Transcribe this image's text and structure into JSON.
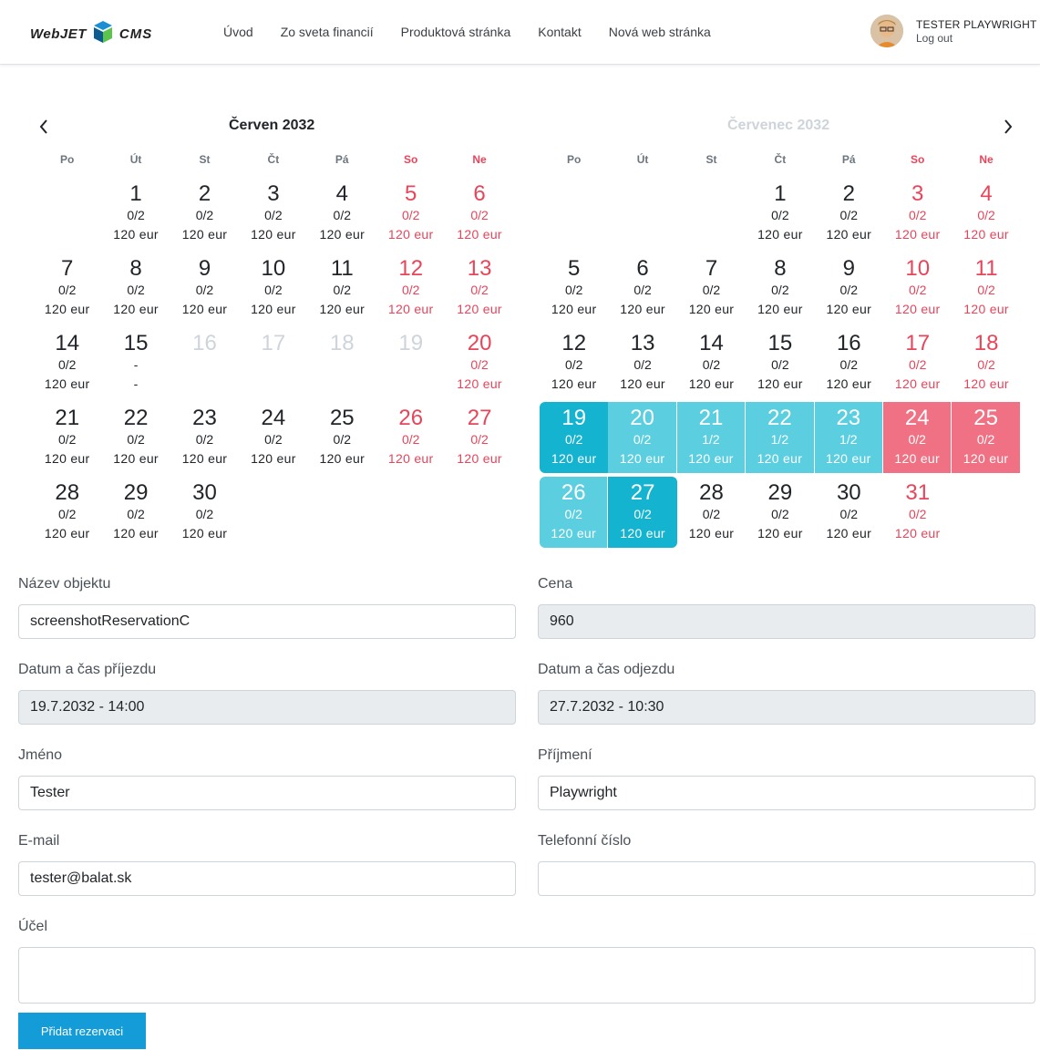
{
  "header": {
    "logo_web": "WebJET",
    "logo_cms": "CMS",
    "nav": [
      "Úvod",
      "Zo sveta financií",
      "Produktová stránka",
      "Kontakt",
      "Nová web stránka"
    ],
    "user_name": "TESTER PLAYWRIGHT",
    "logout": "Log out"
  },
  "calendar": {
    "dow": [
      "Po",
      "Út",
      "St",
      "Čt",
      "Pá",
      "So",
      "Ne"
    ],
    "left_title": "Červen  2032",
    "right_title": "Červenec  2032",
    "prev_icon": "chevron-left-icon",
    "next_icon": "chevron-right-icon",
    "june": [
      {
        "d": "1",
        "o": "0/2",
        "p": "120 eur"
      },
      {
        "d": "2",
        "o": "0/2",
        "p": "120 eur"
      },
      {
        "d": "3",
        "o": "0/2",
        "p": "120 eur"
      },
      {
        "d": "4",
        "o": "0/2",
        "p": "120 eur"
      },
      {
        "d": "5",
        "o": "0/2",
        "p": "120 eur"
      },
      {
        "d": "6",
        "o": "0/2",
        "p": "120 eur"
      },
      {
        "d": "7",
        "o": "0/2",
        "p": "120 eur"
      },
      {
        "d": "8",
        "o": "0/2",
        "p": "120 eur"
      },
      {
        "d": "9",
        "o": "0/2",
        "p": "120 eur"
      },
      {
        "d": "10",
        "o": "0/2",
        "p": "120 eur"
      },
      {
        "d": "11",
        "o": "0/2",
        "p": "120 eur"
      },
      {
        "d": "12",
        "o": "0/2",
        "p": "120 eur"
      },
      {
        "d": "13",
        "o": "0/2",
        "p": "120 eur"
      },
      {
        "d": "14",
        "o": "0/2",
        "p": "120 eur"
      },
      {
        "d": "15",
        "o": "-",
        "p": "-"
      },
      {
        "d": "16",
        "o": "",
        "p": ""
      },
      {
        "d": "17",
        "o": "",
        "p": ""
      },
      {
        "d": "18",
        "o": "",
        "p": ""
      },
      {
        "d": "19",
        "o": "",
        "p": ""
      },
      {
        "d": "20",
        "o": "0/2",
        "p": "120 eur"
      },
      {
        "d": "21",
        "o": "0/2",
        "p": "120 eur"
      },
      {
        "d": "22",
        "o": "0/2",
        "p": "120 eur"
      },
      {
        "d": "23",
        "o": "0/2",
        "p": "120 eur"
      },
      {
        "d": "24",
        "o": "0/2",
        "p": "120 eur"
      },
      {
        "d": "25",
        "o": "0/2",
        "p": "120 eur"
      },
      {
        "d": "26",
        "o": "0/2",
        "p": "120 eur"
      },
      {
        "d": "27",
        "o": "0/2",
        "p": "120 eur"
      },
      {
        "d": "28",
        "o": "0/2",
        "p": "120 eur"
      },
      {
        "d": "29",
        "o": "0/2",
        "p": "120 eur"
      },
      {
        "d": "30",
        "o": "0/2",
        "p": "120 eur"
      }
    ],
    "july": [
      {
        "d": "1",
        "o": "0/2",
        "p": "120 eur"
      },
      {
        "d": "2",
        "o": "0/2",
        "p": "120 eur"
      },
      {
        "d": "3",
        "o": "0/2",
        "p": "120 eur"
      },
      {
        "d": "4",
        "o": "0/2",
        "p": "120 eur"
      },
      {
        "d": "5",
        "o": "0/2",
        "p": "120 eur"
      },
      {
        "d": "6",
        "o": "0/2",
        "p": "120 eur"
      },
      {
        "d": "7",
        "o": "0/2",
        "p": "120 eur"
      },
      {
        "d": "8",
        "o": "0/2",
        "p": "120 eur"
      },
      {
        "d": "9",
        "o": "0/2",
        "p": "120 eur"
      },
      {
        "d": "10",
        "o": "0/2",
        "p": "120 eur"
      },
      {
        "d": "11",
        "o": "0/2",
        "p": "120 eur"
      },
      {
        "d": "12",
        "o": "0/2",
        "p": "120 eur"
      },
      {
        "d": "13",
        "o": "0/2",
        "p": "120 eur"
      },
      {
        "d": "14",
        "o": "0/2",
        "p": "120 eur"
      },
      {
        "d": "15",
        "o": "0/2",
        "p": "120 eur"
      },
      {
        "d": "16",
        "o": "0/2",
        "p": "120 eur"
      },
      {
        "d": "17",
        "o": "0/2",
        "p": "120 eur"
      },
      {
        "d": "18",
        "o": "0/2",
        "p": "120 eur"
      },
      {
        "d": "19",
        "o": "0/2",
        "p": "120 eur"
      },
      {
        "d": "20",
        "o": "0/2",
        "p": "120 eur"
      },
      {
        "d": "21",
        "o": "1/2",
        "p": "120 eur"
      },
      {
        "d": "22",
        "o": "1/2",
        "p": "120 eur"
      },
      {
        "d": "23",
        "o": "1/2",
        "p": "120 eur"
      },
      {
        "d": "24",
        "o": "0/2",
        "p": "120 eur"
      },
      {
        "d": "25",
        "o": "0/2",
        "p": "120 eur"
      },
      {
        "d": "26",
        "o": "0/2",
        "p": "120 eur"
      },
      {
        "d": "27",
        "o": "0/2",
        "p": "120 eur"
      },
      {
        "d": "28",
        "o": "0/2",
        "p": "120 eur"
      },
      {
        "d": "29",
        "o": "0/2",
        "p": "120 eur"
      },
      {
        "d": "30",
        "o": "0/2",
        "p": "120 eur"
      },
      {
        "d": "31",
        "o": "0/2",
        "p": "120 eur"
      }
    ],
    "june_disabled": [
      "16",
      "17",
      "18",
      "19"
    ],
    "july_selected": [
      "19",
      "20",
      "21",
      "22",
      "23",
      "24",
      "25",
      "26",
      "27"
    ],
    "colors": {
      "weekend": "#e8445a",
      "selected": "#5bcfe0",
      "selected_edge": "#14b3cf",
      "selected_weekend": "#ef7183"
    }
  },
  "form": {
    "object_label": "Název objektu",
    "object_value": "screenshotReservationC",
    "price_label": "Cena",
    "price_value": "960",
    "arrival_label": "Datum a čas příjezdu",
    "arrival_value": "19.7.2032 - 14:00",
    "departure_label": "Datum a čas odjezdu",
    "departure_value": "27.7.2032 - 10:30",
    "name_label": "Jméno",
    "name_value": "Tester",
    "surname_label": "Příjmení",
    "surname_value": "Playwright",
    "email_label": "E-mail",
    "email_value": "tester@balat.sk",
    "phone_label": "Telefonní číslo",
    "phone_value": "",
    "purpose_label": "Účel",
    "purpose_value": "",
    "submit_label": "Přidat rezervaci"
  }
}
